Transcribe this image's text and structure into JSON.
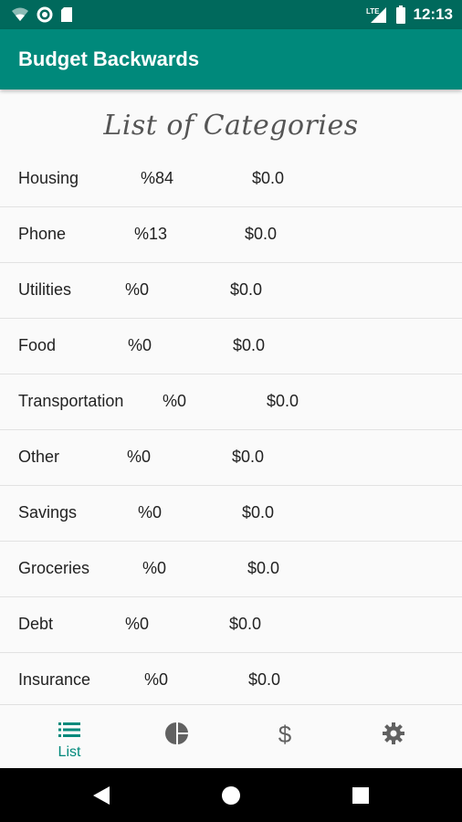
{
  "status_bar": {
    "time": "12:13",
    "network": "LTE"
  },
  "app_bar": {
    "title": "Budget Backwards"
  },
  "heading": "List of Categories",
  "categories": [
    {
      "name": "Housing",
      "percent": "%84",
      "amount": "$0.0"
    },
    {
      "name": "Phone",
      "percent": "%13",
      "amount": "$0.0"
    },
    {
      "name": "Utilities",
      "percent": "%0",
      "amount": "$0.0"
    },
    {
      "name": "Food",
      "percent": "%0",
      "amount": "$0.0"
    },
    {
      "name": "Transportation",
      "percent": "%0",
      "amount": "$0.0"
    },
    {
      "name": "Other",
      "percent": "%0",
      "amount": "$0.0"
    },
    {
      "name": "Savings",
      "percent": "%0",
      "amount": "$0.0"
    },
    {
      "name": "Groceries",
      "percent": "%0",
      "amount": "$0.0"
    },
    {
      "name": "Debt",
      "percent": "%0",
      "amount": "$0.0"
    },
    {
      "name": "Insurance",
      "percent": "%0",
      "amount": "$0.0"
    }
  ],
  "bottom_nav": {
    "items": [
      {
        "label": "List",
        "icon": "list-icon",
        "active": true
      },
      {
        "label": "",
        "icon": "pie-chart-icon",
        "active": false
      },
      {
        "label": "",
        "icon": "dollar-icon",
        "active": false
      },
      {
        "label": "",
        "icon": "gear-icon",
        "active": false
      }
    ],
    "active_color": "#00897b",
    "inactive_color": "#616161"
  },
  "colors": {
    "primary": "#00897b",
    "primary_dark": "#00695c"
  }
}
